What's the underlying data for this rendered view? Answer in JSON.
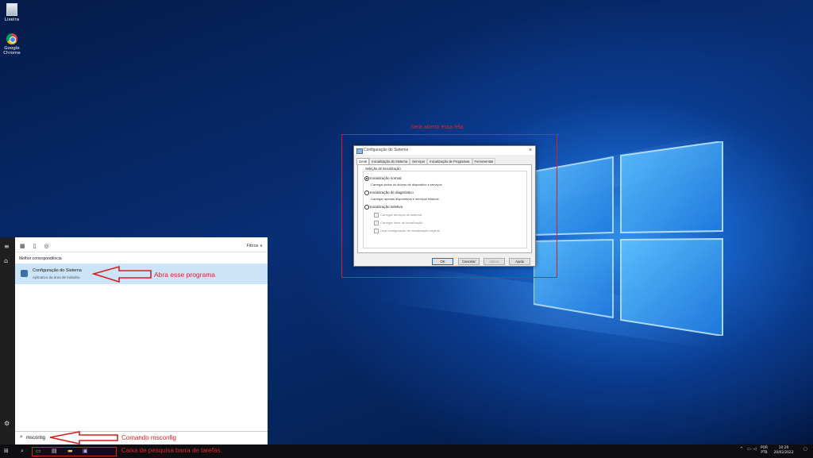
{
  "desktop": {
    "icons": [
      {
        "label": "Lixeira"
      },
      {
        "label_line1": "Google",
        "label_line2": "Chrome"
      }
    ]
  },
  "annotations": {
    "screen_note": "Será aberto essa tela",
    "open_program_note": "Abra esse programa",
    "command_note": "Comando msconfig",
    "taskbar_note": "Caixa de pesquisa barra de tarefas.",
    "color": "#e22222"
  },
  "dialog": {
    "title": "Configuração do Sistema",
    "tabs": [
      "Geral",
      "Inicialização do Sistema",
      "Serviços",
      "Inicialização de Programas",
      "Ferramentas"
    ],
    "group_label": "Seleção de inicialização",
    "options": [
      {
        "label": "Inicialização normal",
        "desc": "Carregar todos os drivers de dispositivo e serviços",
        "selected": true
      },
      {
        "label": "Inicialização de diagnóstico",
        "desc": "Carregar apenas dispositivos e serviços básicos",
        "selected": false
      },
      {
        "label": "Inicialização seletiva",
        "selected": false
      }
    ],
    "checkboxes": [
      "Carregar serviços do sistema",
      "Carregar itens de inicialização",
      "Usar configuração de inicialização original"
    ],
    "buttons": {
      "ok": "OK",
      "cancel": "Cancelar",
      "apply": "Aplicar",
      "help": "Ajuda"
    }
  },
  "search_panel": {
    "filters_label": "Filtros",
    "best_match_label": "Melhor correspondência",
    "result_title": "Configuração do Sistema",
    "result_subtitle": "Aplicativo da área de trabalho",
    "query": "msconfig"
  },
  "taskbar": {
    "lang_line1": "POR",
    "lang_line2": "PTB",
    "time": "10:29",
    "date": "20/02/2022"
  },
  "colors": {
    "accent": "#0078d7",
    "taskbar": "#0e0e12",
    "selection": "#cce4f7"
  }
}
